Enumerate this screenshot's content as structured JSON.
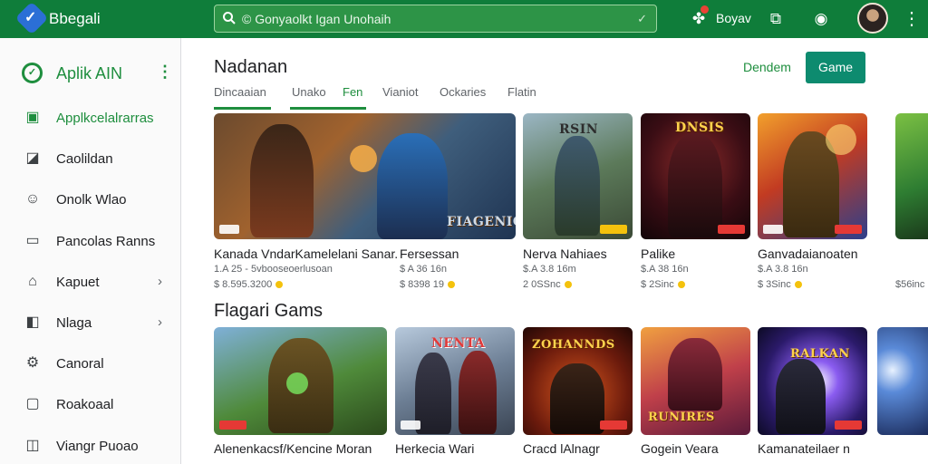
{
  "app": {
    "brand": "Bbegali",
    "search_text": "© Gonyaolkt Igan Unohaih",
    "user_name": "Boyav"
  },
  "colors": {
    "topbar": "#0f7d3a",
    "accent": "#1e8e3e",
    "primary_button": "#0d8b6f"
  },
  "icons": [
    "logo-icon",
    "search-icon",
    "mic-icon",
    "gamepad-icon",
    "bookmark-icon",
    "notification-icon",
    "avatar",
    "more-vert-icon"
  ],
  "sidebar": {
    "title": "Aplik AIN",
    "items": [
      {
        "label": "Applkcelalrarras",
        "icon": "apps-icon",
        "active": true
      },
      {
        "label": "Caolildan",
        "icon": "document-icon"
      },
      {
        "label": "Onolk Wlao",
        "icon": "chat-icon"
      },
      {
        "label": "Pancolas Ranns",
        "icon": "monitor-icon"
      },
      {
        "label": "Kapuet",
        "icon": "home-icon",
        "chevron": true
      },
      {
        "label": "Nlaga",
        "icon": "chart-icon",
        "chevron": true
      },
      {
        "label": "Canoral",
        "icon": "settings-icon"
      },
      {
        "label": "Roakoaal",
        "icon": "window-icon"
      },
      {
        "label": "Viangr Puoao",
        "icon": "library-icon"
      }
    ]
  },
  "main": {
    "title": "Nadanan",
    "secondary_button": "Dendem",
    "primary_button": "Game",
    "tabs": [
      "Dincaaian",
      "Unako",
      "Fen",
      "Vianiot",
      "Ockaries",
      "Flatin"
    ],
    "section_title": "Flagari Gams"
  },
  "row1": [
    {
      "name": "Kanada VndarKamelelani Sanar.",
      "meta1": "1.A 25 - 5vbooseoerlusoan",
      "meta2": "$ 8.595.3200",
      "banner": "FIAGENICT"
    },
    {
      "name": "Fersessan",
      "meta1": "$ A 36 16n",
      "meta2": "$ 8398 19",
      "banner": ""
    },
    {
      "name": "Nerva Nahiaes",
      "meta1": "$.A 3.8 16m",
      "meta2": "2 0SSnc",
      "banner": "RSIN"
    },
    {
      "name": "Palike",
      "meta1": "$.A 38 16n",
      "meta2": "$ 2Sinc",
      "banner": "DNSIS"
    },
    {
      "name": "Ganvadaianoaten",
      "meta1": "$.A 3.8 16n",
      "meta2": "$ 3Sinc",
      "banner": ""
    },
    {
      "name": "",
      "meta1": "",
      "meta2": "$56inc",
      "banner": ""
    }
  ],
  "row2": [
    {
      "name": "Alenenkacsf/Kencine Moran",
      "banner": ""
    },
    {
      "name": "Herkecia Wari",
      "banner": "NENTA"
    },
    {
      "name": "Cracd lAlnagr",
      "banner": "ZOHANNDS"
    },
    {
      "name": "Gogein Veara",
      "banner": "RUNIRES"
    },
    {
      "name": "Kamanateilaer n",
      "banner": "RALKAN"
    },
    {
      "name": "",
      "banner": ""
    }
  ]
}
